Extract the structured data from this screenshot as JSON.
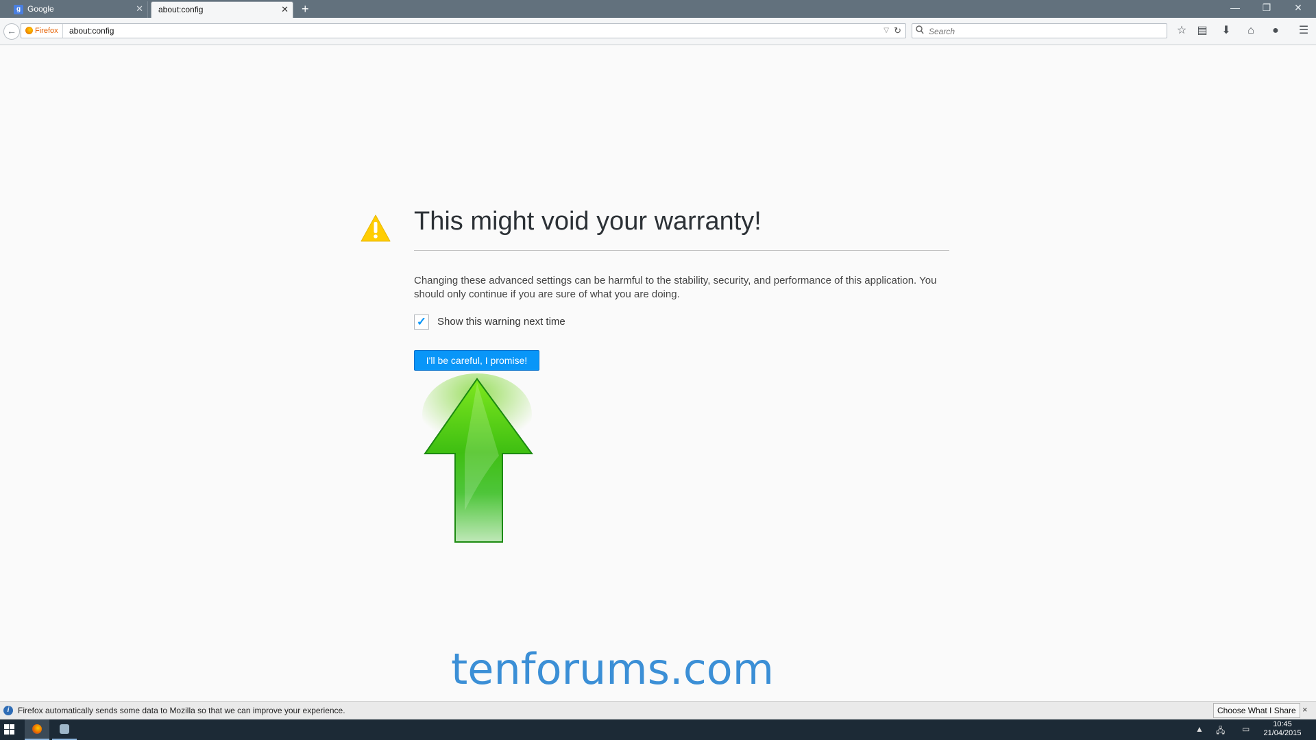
{
  "browser": {
    "tabs": [
      {
        "label": "Google",
        "favicon": "g"
      },
      {
        "label": "about:config"
      }
    ],
    "new_tab": "+",
    "identity_label": "Firefox",
    "url": "about:config",
    "search_placeholder": "Search"
  },
  "page": {
    "title": "This might void your warranty!",
    "description": "Changing these advanced settings can be harmful to the stability, security, and performance of this application. You should only continue if you are sure of what you are doing.",
    "checkbox_label": "Show this warning next time",
    "checkbox_checked": true,
    "confirm_button": "I'll be careful, I promise!",
    "watermark": "tenforums.com",
    "accent_color": "#0996f8"
  },
  "notification": {
    "text": "Firefox automatically sends some data to Mozilla so that we can improve your experience.",
    "button": "Choose What I Share",
    "close": "×"
  },
  "taskbar": {
    "time": "10:45",
    "date": "21/04/2015"
  }
}
